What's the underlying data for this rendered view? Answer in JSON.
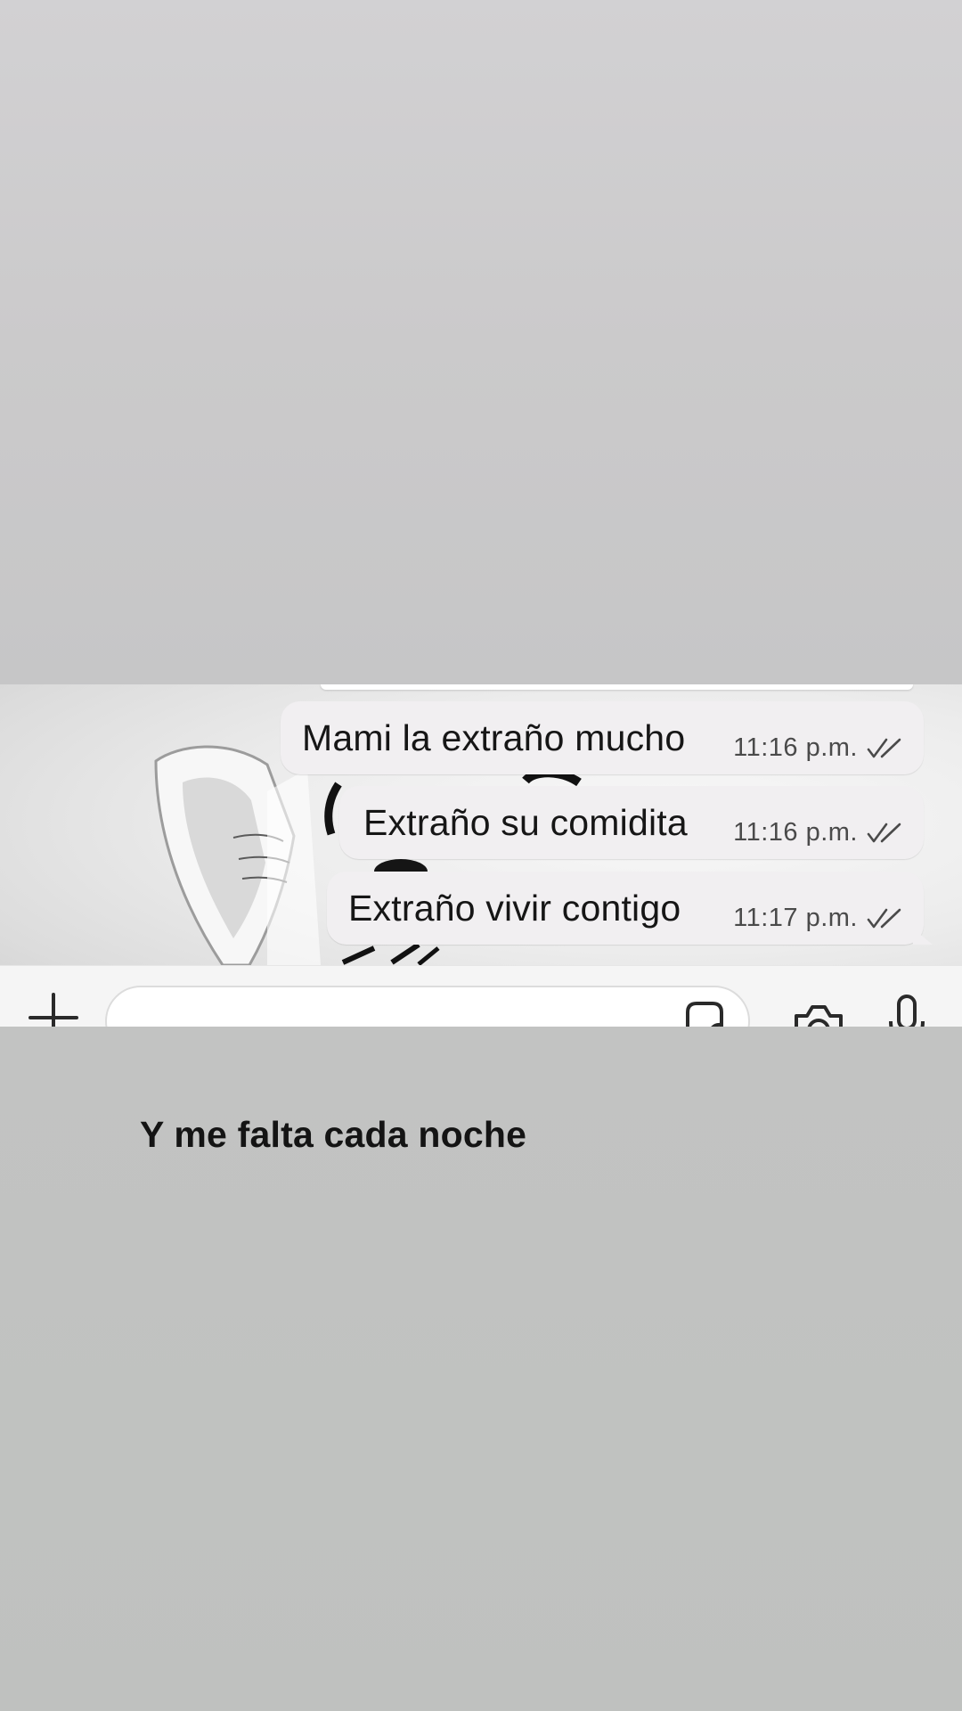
{
  "messages": [
    {
      "text": "Mami la extraño mucho",
      "time": "11:16 p.m.",
      "status_icon": "double-check-icon"
    },
    {
      "text": "Extraño su comidita",
      "time": "11:16 p.m.",
      "status_icon": "double-check-icon"
    },
    {
      "text": "Extraño vivir contigo",
      "time": "11:17 p.m.",
      "status_icon": "double-check-icon"
    }
  ],
  "input_bar": {
    "icons": [
      "plus-icon",
      "sticker-icon",
      "camera-icon",
      "microphone-icon"
    ],
    "compose_value": ""
  },
  "caption": "Y me falta cada noche",
  "colors": {
    "bubble": "#f1eff1",
    "background_top": "#cbcacb",
    "background_bottom": "#bfc1bf",
    "caption_text": "#141414"
  }
}
